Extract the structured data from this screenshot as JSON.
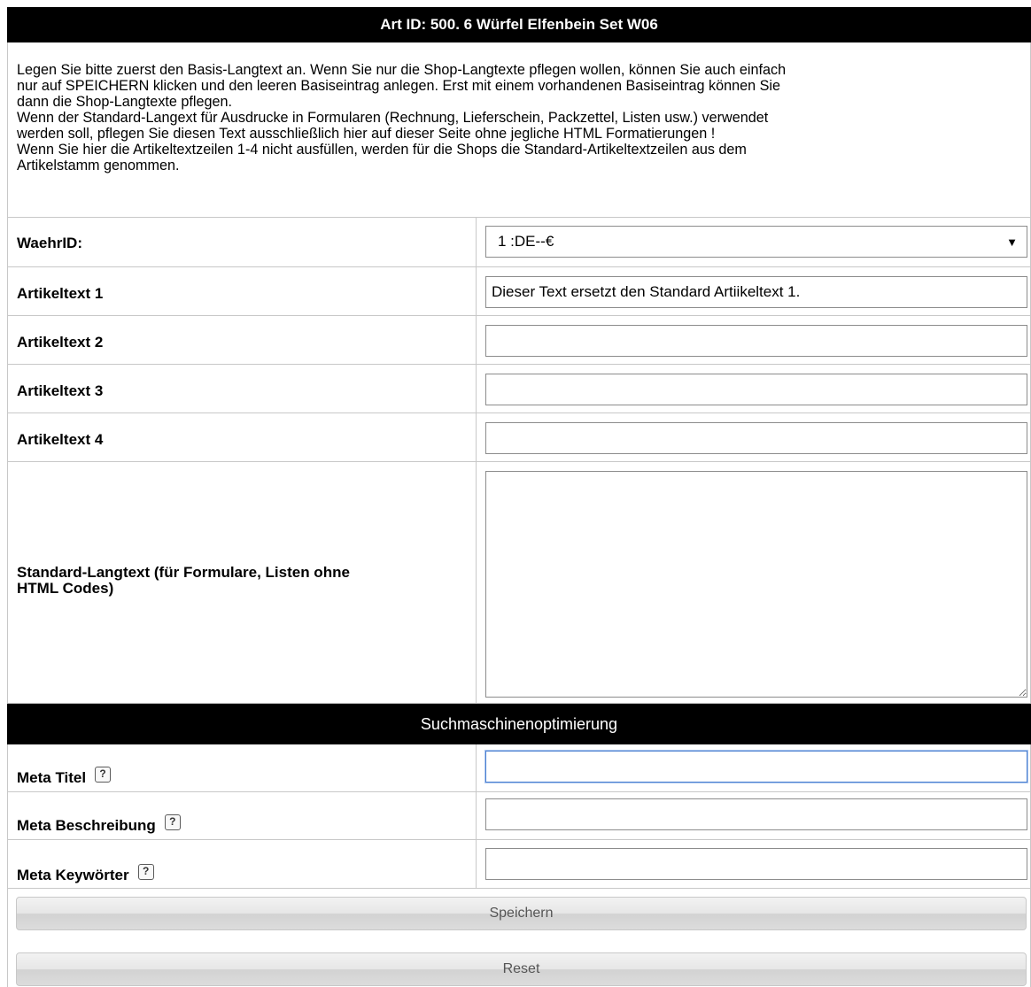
{
  "header": {
    "title": "Art ID: 500. 6 Würfel Elfenbein Set W06"
  },
  "intro": {
    "lines": [
      "Legen Sie bitte zuerst den Basis-Langtext an. Wenn Sie nur die Shop-Langtexte pflegen wollen, können Sie auch einfach",
      "nur auf SPEICHERN klicken und den leeren Basiseintrag anlegen. Erst mit einem vorhandenen Basiseintrag können Sie",
      "dann die Shop-Langtexte pflegen.",
      "Wenn der Standard-Langext für Ausdrucke in Formularen (Rechnung, Lieferschein, Packzettel, Listen usw.) verwendet",
      "werden soll, pflegen Sie diesen Text ausschließlich hier auf dieser Seite ohne jegliche HTML Formatierungen !",
      "Wenn Sie hier die Artikeltextzeilen 1-4 nicht ausfüllen, werden für die Shops die Standard-Artikeltextzeilen aus dem",
      "Artikelstamm genommen."
    ]
  },
  "form": {
    "waehr": {
      "label": "WaehrID:",
      "value": "1 :DE--€"
    },
    "artikeltext1": {
      "label": "Artikeltext 1",
      "value": "Dieser Text ersetzt den Standard Artiikeltext 1."
    },
    "artikeltext2": {
      "label": "Artikeltext 2",
      "value": ""
    },
    "artikeltext3": {
      "label": "Artikeltext 3",
      "value": ""
    },
    "artikeltext4": {
      "label": "Artikeltext 4",
      "value": ""
    },
    "langtext": {
      "label_line1": "Standard-Langtext (für Formulare, Listen ohne",
      "label_line2": "HTML Codes)",
      "value": ""
    }
  },
  "seo": {
    "title": "Suchmaschinenoptimierung",
    "help_glyph": "?",
    "meta_titel": {
      "label": "Meta Titel",
      "value": ""
    },
    "meta_beschreibung": {
      "label": "Meta Beschreibung",
      "value": ""
    },
    "meta_keywoerter": {
      "label": "Meta Keywörter",
      "value": ""
    }
  },
  "buttons": {
    "save": "Speichern",
    "reset": "Reset"
  }
}
